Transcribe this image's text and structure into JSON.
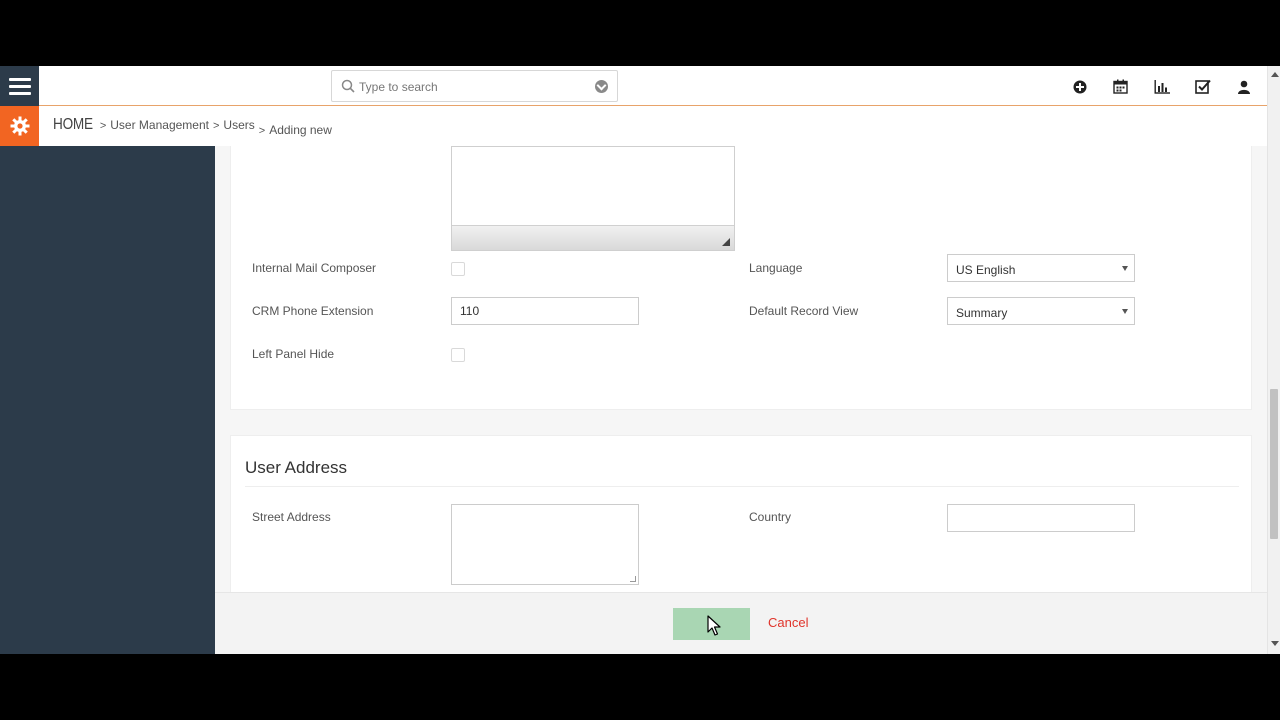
{
  "search": {
    "placeholder": "Type to search"
  },
  "top_icons": [
    "add-circle-icon",
    "calendar-icon",
    "bar-chart-icon",
    "task-check-icon",
    "user-icon"
  ],
  "breadcrumb": {
    "home": "HOME",
    "items": [
      "User Management",
      "Users"
    ],
    "current": "Adding new",
    "separator": ">"
  },
  "form": {
    "internal_mail_composer": {
      "label": "Internal Mail Composer",
      "checked": false
    },
    "language": {
      "label": "Language",
      "value": "US English"
    },
    "crm_phone_extension": {
      "label": "CRM Phone Extension",
      "value": "110"
    },
    "default_record_view": {
      "label": "Default Record View",
      "value": "Summary"
    },
    "left_panel_hide": {
      "label": "Left Panel Hide",
      "checked": false
    }
  },
  "address_section": {
    "title": "User Address",
    "street_address": {
      "label": "Street Address",
      "value": ""
    },
    "country": {
      "label": "Country",
      "value": ""
    }
  },
  "footer": {
    "cancel_label": "Cancel"
  },
  "colors": {
    "sidebar": "#2c3b4a",
    "accent": "#f26522",
    "save": "#a9d6b3",
    "cancel": "#e0342b"
  }
}
